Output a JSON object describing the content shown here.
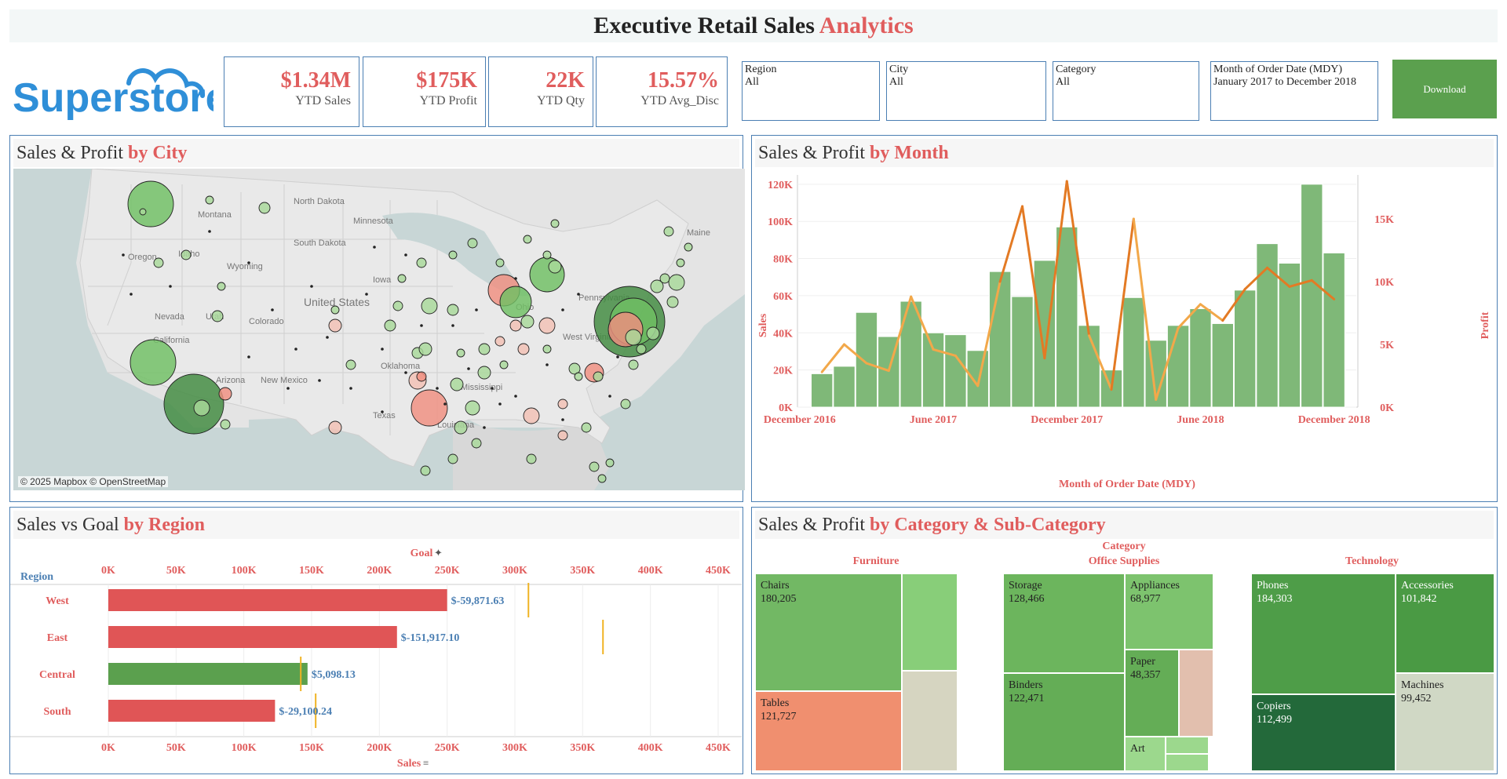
{
  "header": {
    "title_main": "Executive Retail Sales",
    "title_accent": "Analytics",
    "logo_text": "Superstore",
    "download_label": "Download"
  },
  "kpis": [
    {
      "value": "$1.34M",
      "label": "YTD Sales"
    },
    {
      "value": "$175K",
      "label": "YTD Profit"
    },
    {
      "value": "22K",
      "label": "YTD Qty"
    },
    {
      "value": "15.57%",
      "label": "YTD Avg_Disc"
    }
  ],
  "filters": [
    {
      "label": "Region",
      "value": "All"
    },
    {
      "label": "City",
      "value": "All"
    },
    {
      "label": "Category",
      "value": "All"
    },
    {
      "label": "Month of Order Date (MDY)",
      "value": "January 2017 to December 2018"
    }
  ],
  "map_panel": {
    "title_main": "Sales & Profit",
    "title_accent": "by City",
    "credit": "© 2025 Mapbox © OpenStreetMap",
    "labels": [
      "Montana",
      "North Dakota",
      "South Dakota",
      "Minnesota",
      "Oregon",
      "Idaho",
      "Wyoming",
      "Iowa",
      "Nevada",
      "Utah",
      "United States",
      "Colorado",
      "California",
      "Arizona",
      "New Mexico",
      "Oklahoma",
      "Texas",
      "Louisiana",
      "Mississippi",
      "Maine",
      "Pennsylvania",
      "West Virginia",
      "Ohio"
    ]
  },
  "month_panel": {
    "title_main": "Sales & Profit",
    "title_accent": "by Month",
    "xlabel": "Month of Order Date (MDY)",
    "ylabel_left": "Sales",
    "ylabel_right": "Profit",
    "left_ticks": [
      "120K",
      "100K",
      "80K",
      "60K",
      "40K",
      "20K",
      "0K"
    ],
    "right_ticks": [
      "15K",
      "10K",
      "5K",
      "0K"
    ],
    "x_ticks": [
      "December 2016",
      "June 2017",
      "December 2017",
      "June 2018",
      "December 2018"
    ]
  },
  "region_panel": {
    "title_main": "Sales vs Goal",
    "title_accent": "by Region",
    "row_header": "Region",
    "goal_label": "Goal",
    "sales_label": "Sales",
    "x_ticks": [
      "0K",
      "50K",
      "100K",
      "150K",
      "200K",
      "250K",
      "300K",
      "350K",
      "400K",
      "450K"
    ]
  },
  "category_panel": {
    "title_main": "Sales & Profit",
    "title_accent": "by Category & Sub-Category",
    "category_header": "Category",
    "categories": [
      "Furniture",
      "Office Supplies",
      "Technology"
    ],
    "cells": [
      {
        "name": "Chairs",
        "value": "180,205"
      },
      {
        "name": "Tables",
        "value": "121,727"
      },
      {
        "name": "Storage",
        "value": "128,466"
      },
      {
        "name": "Appliances",
        "value": "68,977"
      },
      {
        "name": "Binders",
        "value": "122,471"
      },
      {
        "name": "Paper",
        "value": "48,357"
      },
      {
        "name": "Art",
        "value": ""
      },
      {
        "name": "Phones",
        "value": "184,303"
      },
      {
        "name": "Accessories",
        "value": "101,842"
      },
      {
        "name": "Copiers",
        "value": "112,499"
      },
      {
        "name": "Machines",
        "value": "99,452"
      }
    ]
  },
  "colors": {
    "accent_red": "#e05d5d",
    "profit_green": "#5ba04e",
    "border_blue": "#4b7fb3",
    "goal_gold": "#f0b323"
  },
  "chart_data": [
    {
      "type": "bar",
      "title": "Sales & Profit by Month",
      "xlabel": "Month of Order Date (MDY)",
      "ylabel": "Sales",
      "categories": [
        "Jan 2017",
        "Feb 2017",
        "Mar 2017",
        "Apr 2017",
        "May 2017",
        "Jun 2017",
        "Jul 2017",
        "Aug 2017",
        "Sep 2017",
        "Oct 2017",
        "Nov 2017",
        "Dec 2017",
        "Jan 2018",
        "Feb 2018",
        "Mar 2018",
        "Apr 2018",
        "May 2018",
        "Jun 2018",
        "Jul 2018",
        "Aug 2018",
        "Sep 2018",
        "Oct 2018",
        "Nov 2018",
        "Dec 2018"
      ],
      "series": [
        {
          "name": "Sales",
          "values": [
            18000,
            22000,
            51000,
            38000,
            57000,
            40000,
            39000,
            30500,
            73000,
            59500,
            79000,
            97000,
            44000,
            20000,
            59000,
            36000,
            44000,
            53000,
            45000,
            63000,
            88000,
            77500,
            120000,
            83000
          ]
        },
        {
          "name": "Profit",
          "values": [
            2800,
            5000,
            3500,
            2900,
            8800,
            4600,
            4100,
            1700,
            10000,
            16000,
            3900,
            18000,
            5700,
            1400,
            15000,
            600,
            6300,
            8200,
            6900,
            9400,
            11100,
            9600,
            10100,
            8600
          ]
        }
      ],
      "ylim": [
        0,
        125000
      ],
      "y2lim": [
        0,
        18500
      ]
    },
    {
      "type": "bar",
      "title": "Sales vs Goal by Region",
      "xlabel": "Sales",
      "ylabel": "Region",
      "categories": [
        "West",
        "East",
        "Central",
        "South"
      ],
      "series": [
        {
          "name": "Sales",
          "values": [
            250000,
            213000,
            147000,
            123000
          ]
        },
        {
          "name": "Goal",
          "values": [
            310000,
            365000,
            142000,
            153000
          ]
        }
      ],
      "data_labels": [
        "$-59,871.63",
        "$-151,917.10",
        "$5,098.13",
        "$-29,100.24"
      ],
      "xlim": [
        0,
        450000
      ]
    }
  ]
}
